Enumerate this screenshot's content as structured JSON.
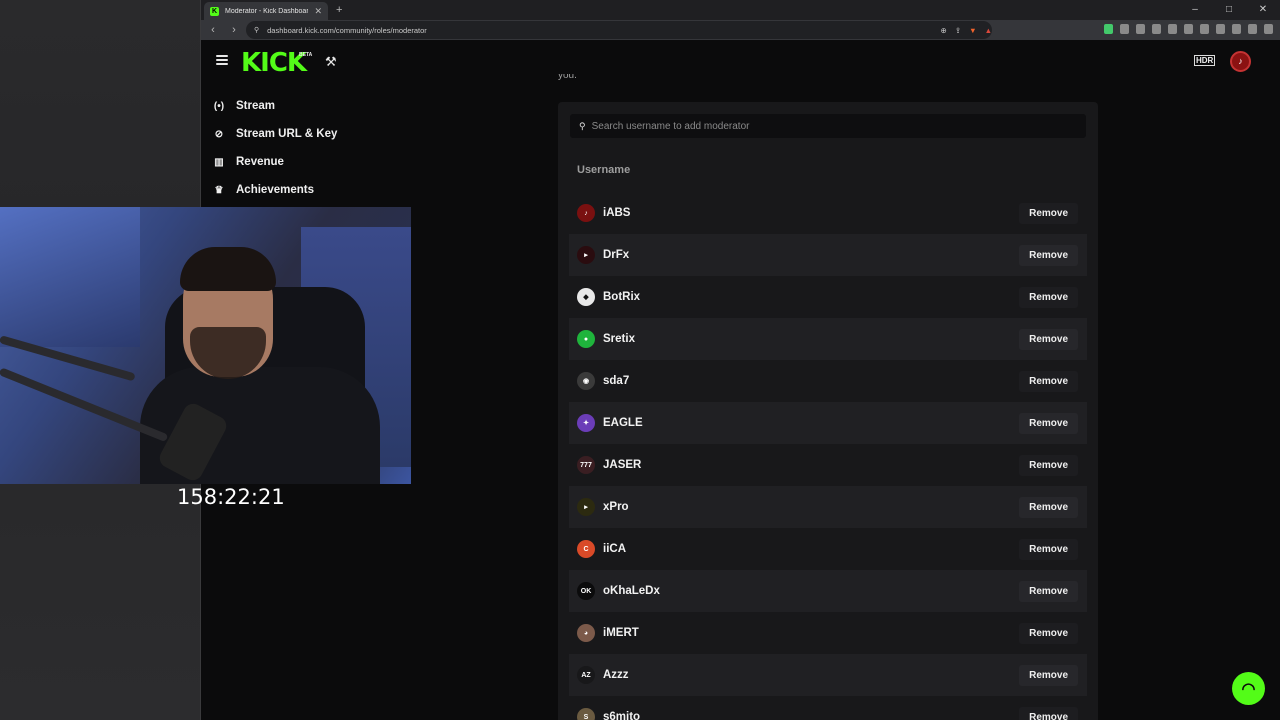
{
  "browser": {
    "tab_title": "Moderator - Kick Dashboard",
    "new_tab": "+",
    "url": "dashboard.kick.com/community/roles/moderator",
    "window_controls": [
      "–",
      "□",
      "✕"
    ]
  },
  "header": {
    "logo": "KICK",
    "beta": "BETA",
    "badge": "HDR"
  },
  "sidebar": {
    "items": [
      {
        "label": "Stream",
        "icon": "broadcast-icon"
      },
      {
        "label": "Stream URL & Key",
        "icon": "link-icon"
      },
      {
        "label": "Revenue",
        "icon": "chart-icon"
      },
      {
        "label": "Achievements",
        "icon": "trophy-icon"
      }
    ]
  },
  "overlay": {
    "timer": "158:22:21"
  },
  "moderators": {
    "cut_text": "you.",
    "search_placeholder": "Search username to add moderator",
    "column_header": "Username",
    "remove_label": "Remove",
    "rows": [
      {
        "username": "iABS",
        "avatar_color": "#7a1010",
        "avatar_glyph": "♪"
      },
      {
        "username": "DrFx",
        "avatar_color": "#2a0c0f",
        "avatar_glyph": "▸"
      },
      {
        "username": "BotRix",
        "avatar_color": "#e8e8e8",
        "avatar_glyph": "◆"
      },
      {
        "username": "Sretix",
        "avatar_color": "#1fb43c",
        "avatar_glyph": "●"
      },
      {
        "username": "sda7",
        "avatar_color": "#3a3a3a",
        "avatar_glyph": "◉"
      },
      {
        "username": "EAGLE",
        "avatar_color": "#6b3db8",
        "avatar_glyph": "✦"
      },
      {
        "username": "JASER",
        "avatar_color": "#3a1e22",
        "avatar_glyph": "777"
      },
      {
        "username": "xPro",
        "avatar_color": "#2c2a10",
        "avatar_glyph": "▸"
      },
      {
        "username": "iiCA",
        "avatar_color": "#d94a28",
        "avatar_glyph": "C"
      },
      {
        "username": "oKhaLeDx",
        "avatar_color": "#0b0b0c",
        "avatar_glyph": "OK"
      },
      {
        "username": "iMERT",
        "avatar_color": "#7c5a4a",
        "avatar_glyph": "◕"
      },
      {
        "username": "Azzz",
        "avatar_color": "#18181a",
        "avatar_glyph": "AZ"
      },
      {
        "username": "s6mito",
        "avatar_color": "#6a5a40",
        "avatar_glyph": "S"
      }
    ]
  },
  "colors": {
    "brand": "#53fc18",
    "panel": "#18181a",
    "background": "#0b0b0c"
  }
}
